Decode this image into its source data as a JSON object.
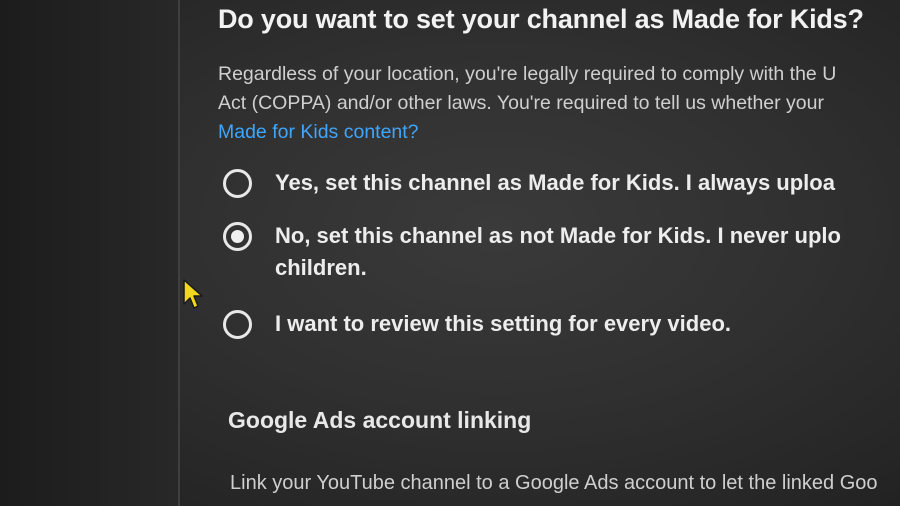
{
  "made_for_kids": {
    "heading": "Do you want to set your channel as Made for Kids?",
    "description_line1": "Regardless of your location, you're legally required to comply with the U",
    "description_line2": "Act (COPPA) and/or other laws. You're required to tell us whether your",
    "learn_link": "Made for Kids content?",
    "options": [
      {
        "label": "Yes, set this channel as Made for Kids. I always uploa",
        "checked": false
      },
      {
        "label": "No, set this channel as not Made for Kids. I never uplo",
        "label_line2": "children.",
        "checked": true
      },
      {
        "label": "I want to review this setting for every video.",
        "checked": false
      }
    ]
  },
  "google_ads": {
    "heading": "Google Ads account linking",
    "description": "Link your YouTube channel to a Google Ads account to let the linked Goo"
  },
  "colors": {
    "link": "#3ea6ff",
    "cursor": "#f2d81c"
  },
  "icons": {
    "cursor": "arrow-cursor-icon"
  }
}
